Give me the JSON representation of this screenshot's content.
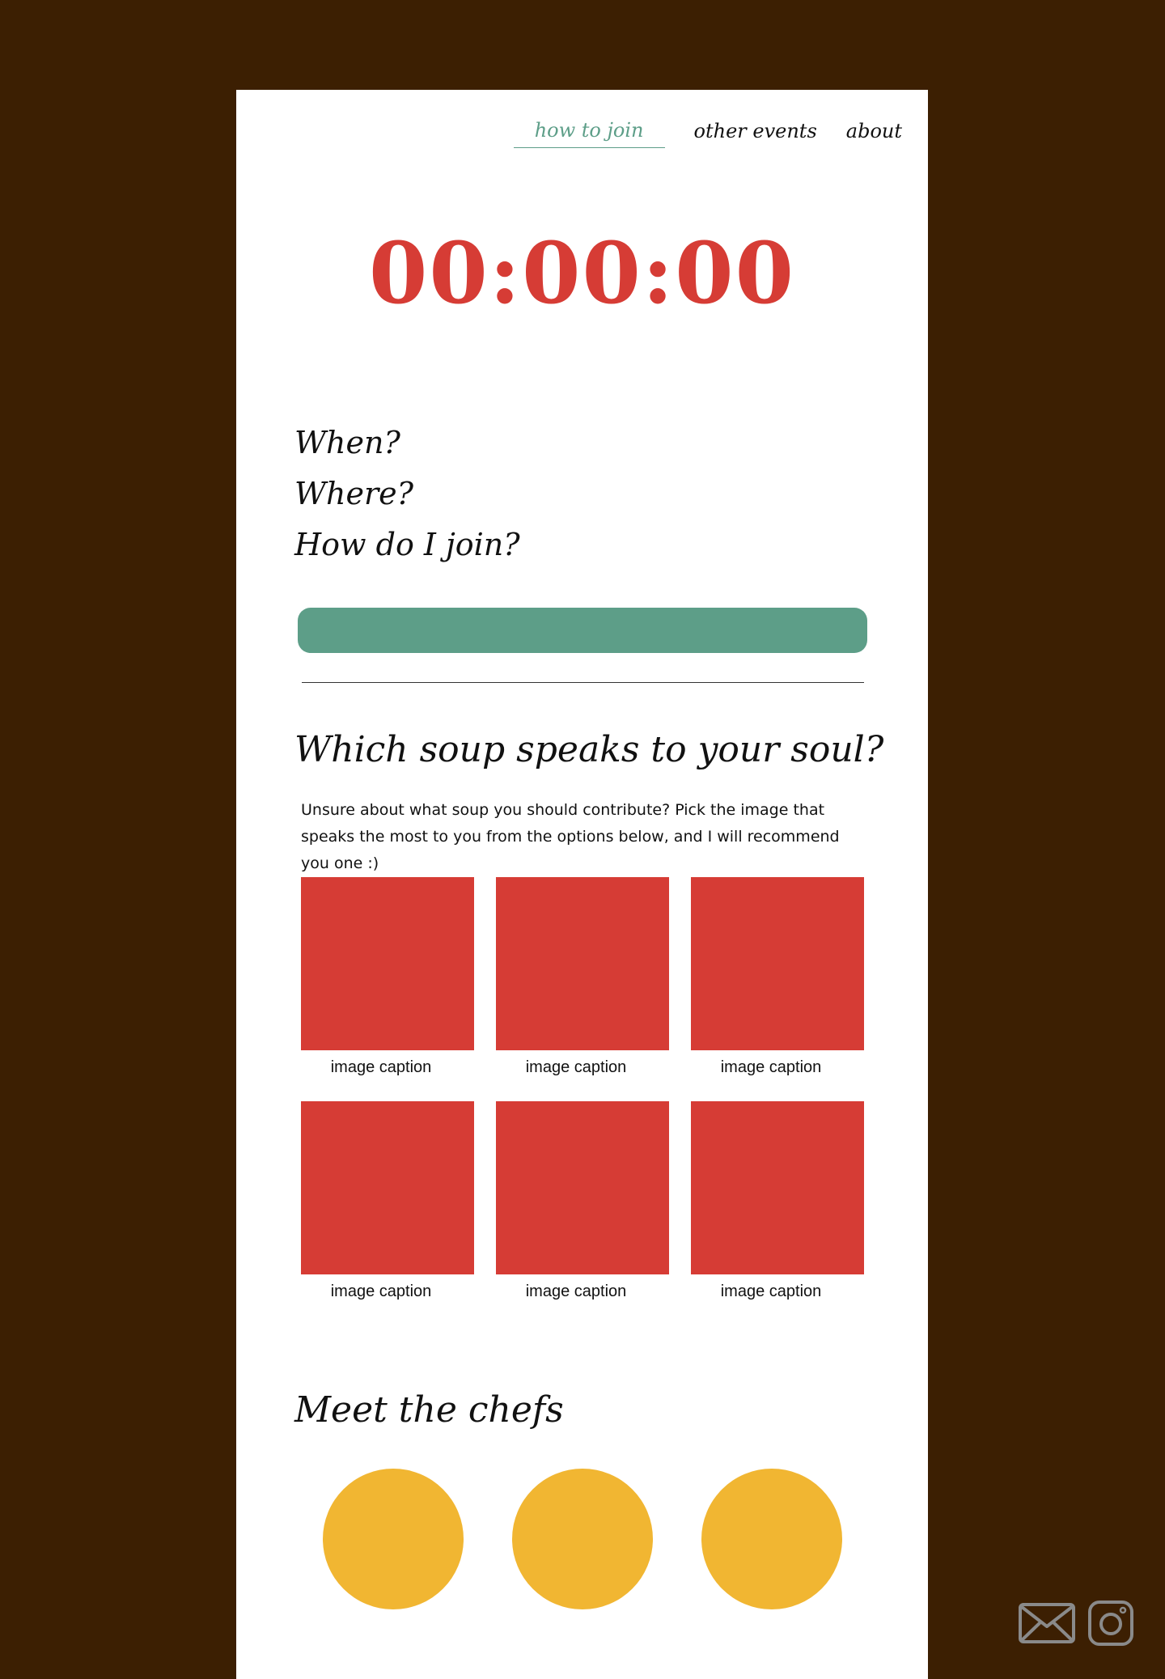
{
  "nav": {
    "links": [
      {
        "label": "how to join",
        "active": true
      },
      {
        "label": "other events",
        "active": false
      },
      {
        "label": "about",
        "active": false
      }
    ]
  },
  "timer": "00:00:00",
  "questions": [
    "When?",
    "Where?",
    "How do I join?"
  ],
  "soup_quiz": {
    "heading": "Which soup speaks to your soul?",
    "description": "Unsure about what soup you should contribute? Pick the image that speaks the most to you from the options below, and I will recommend you one :)",
    "options": [
      {
        "caption": "image caption"
      },
      {
        "caption": "image caption"
      },
      {
        "caption": "image caption"
      },
      {
        "caption": "image caption"
      },
      {
        "caption": "image caption"
      },
      {
        "caption": "image caption"
      }
    ]
  },
  "chefs": {
    "heading": "Meet the chefs",
    "count": 3
  },
  "footer_icons": [
    "mail-icon",
    "instagram-icon"
  ],
  "colors": {
    "background": "#3c1f02",
    "card": "#ffffff",
    "accent_red": "#d63c35",
    "accent_green": "#5d9e88",
    "chef_yellow": "#f1b632",
    "icon_gray": "#8a8a8a"
  }
}
